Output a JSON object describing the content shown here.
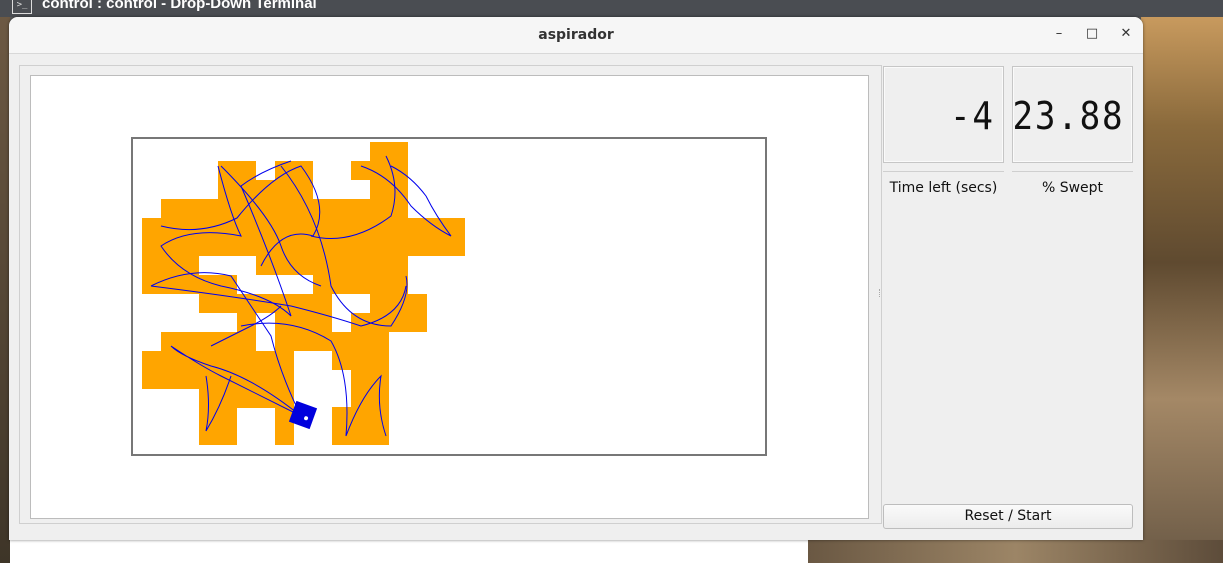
{
  "background": {
    "terminal_title": "control : control - Drop-Down Terminal",
    "terminal_icon": ">_"
  },
  "window": {
    "title": "aspirador",
    "controls": {
      "minimize": "–",
      "maximize": "□",
      "close": "✕"
    }
  },
  "stats": {
    "time_left_value": "-4",
    "time_left_label": "Time left (secs)",
    "swept_value": "23.88",
    "swept_label": "% Swept"
  },
  "actions": {
    "reset_label": "Reset / Start"
  },
  "colors": {
    "swept": "#FFA500",
    "path": "#0000EE",
    "robot": "#0000CC"
  }
}
